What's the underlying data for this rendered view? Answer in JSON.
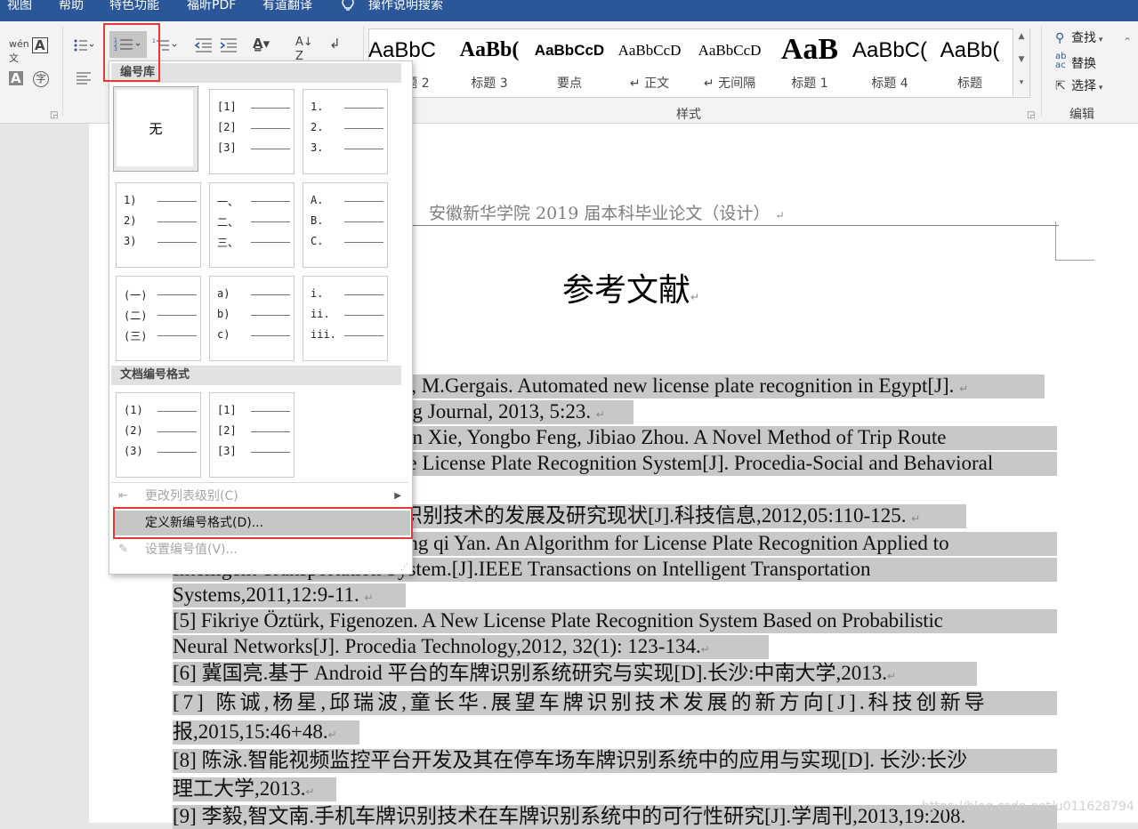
{
  "menubar": {
    "items": [
      "视图",
      "帮助",
      "特色功能",
      "福昕PDF",
      "有道翻译"
    ],
    "search_label": "操作说明搜索"
  },
  "ribbon": {
    "styles_gallery": [
      {
        "preview": "AaBbC",
        "label": "标题 2"
      },
      {
        "preview": "AaBb(",
        "label": "标题 3"
      },
      {
        "preview": "AaBbCcD",
        "label": "要点"
      },
      {
        "preview": "AaBbCcD",
        "label": "↵ 正文"
      },
      {
        "preview": "AaBbCcD",
        "label": "↵ 无间隔"
      },
      {
        "preview": "AaB",
        "label": "标题 1"
      },
      {
        "preview": "AaBbC(",
        "label": "标题 4"
      },
      {
        "preview": "AaBb(",
        "label": "标题"
      }
    ],
    "styles_group_label": "样式",
    "editing": {
      "find": "查找",
      "replace": "替换",
      "select": "选择",
      "group_label": "编辑"
    }
  },
  "numbering_menu": {
    "library_header": "编号库",
    "none_label": "无",
    "library_tiles": [
      [
        "[1]",
        "[2]",
        "[3]"
      ],
      [
        "1.",
        "2.",
        "3."
      ],
      [
        "1)",
        "2)",
        "3)"
      ],
      [
        "一、",
        "二、",
        "三、"
      ],
      [
        "A.",
        "B.",
        "C."
      ],
      [
        "(一)",
        "(二)",
        "(三)"
      ],
      [
        "a)",
        "b)",
        "c)"
      ],
      [
        "i.",
        "ii.",
        "iii."
      ]
    ],
    "document_header": "文档编号格式",
    "document_tiles": [
      [
        "(1)",
        "(2)",
        "(3)"
      ],
      [
        "[1]",
        "[2]",
        "[3]"
      ]
    ],
    "change_level": "更改列表级别(C)",
    "define_new": "定义新编号格式(D)...",
    "set_value": "设置编号值(V)..."
  },
  "document": {
    "header": "安徽新华学院 2019 届本科毕业论文（设计）",
    "title": "参考文献",
    "ref_lines": [
      "e, M.Gergais. Automated new license plate recognition in Egypt[J].",
      "ng Journal, 2013, 5:23.",
      "un Xie, Yongbo Feng, Jibiao Zhou. A Novel Method of Trip Route",
      "le License Plate Recognition System[J]. Procedia-Social and Behavioral",
      "识别技术的发展及研究现状[J].科技信息,2012,05:110-125.",
      "ing qi Yan. An Algorithm for License Plate Recognition Applied to",
      "Intelligent     Transportation     System.[J].IEEE     Transactions     on     Intelligent     Transportation",
      "Systems,2011,12:9-11.",
      "[5] Fikriye Öztürk, Figenozen. A New License Plate Recognition System Based on Probabilistic",
      "Neural Networks[J]. Procedia Technology,2012, 32(1): 123-134.",
      "[6]  冀国亮.基于 Android 平台的车牌识别系统研究与实现[D].长沙:中南大学,2013.",
      "[7]  陈诚,杨星,邱瑞波,童长华.展望车牌识别技术发展的新方向[J].科技创新导",
      "报,2015,15:46+48.",
      "[8]  陈泳.智能视频监控平台开发及其在停车场车牌识别系统中的应用与实现[D]. 长沙:长沙",
      "理工大学,2013.",
      "[9]  李毅,智文南.手机车牌识别技术在车牌识别系统中的可行性研究[J].学周刊,2013,19:208."
    ],
    "watermark": "https://blog.csdn.net/u011628794"
  }
}
